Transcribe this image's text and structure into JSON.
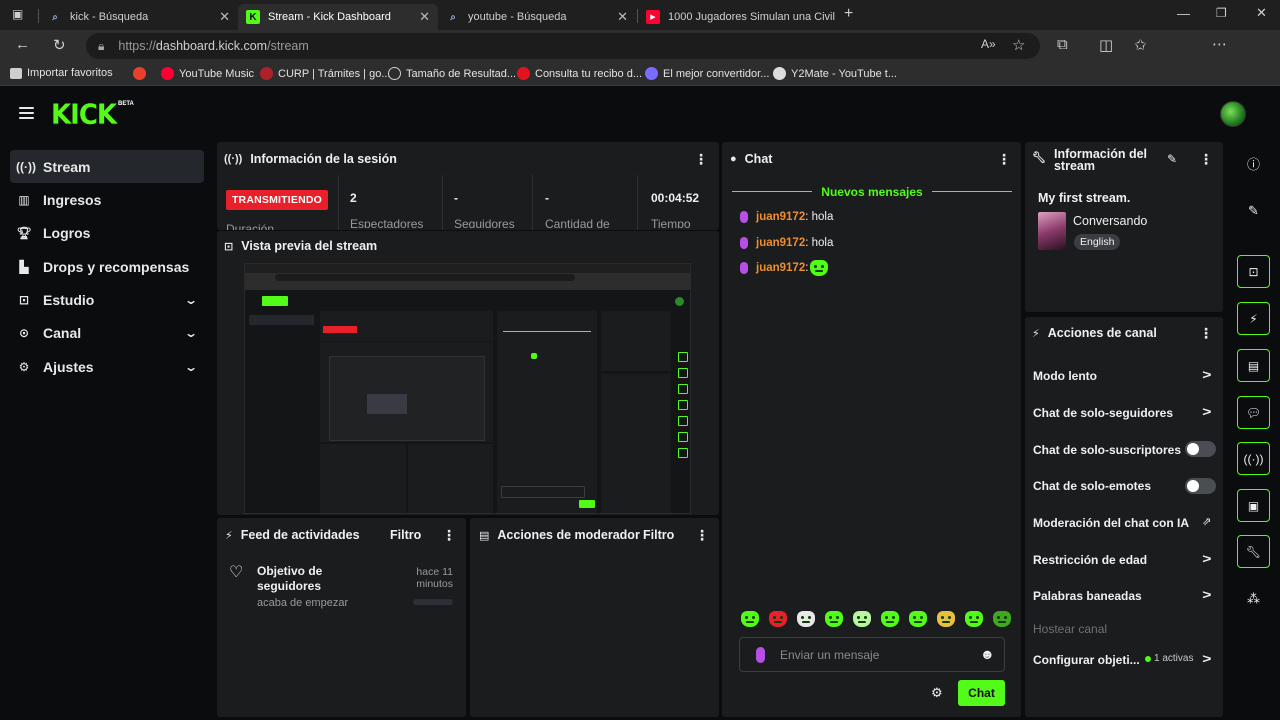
{
  "browser": {
    "tabs": [
      {
        "title": "kick - Búsqueda",
        "icon": "search-icon"
      },
      {
        "title": "Stream - Kick Dashboard",
        "icon": "kick-icon"
      },
      {
        "title": "youtube - Búsqueda",
        "icon": "search-icon"
      },
      {
        "title": "1000 Jugadores Simulan una Civil",
        "icon": "youtube-icon"
      }
    ],
    "url_prefix": "https://",
    "url_domain": "dashboard.kick.com",
    "url_path": "/stream",
    "bookmarks": [
      {
        "label": "Importar favoritos",
        "color": "#cfcfcf"
      },
      {
        "label": "",
        "color": "#e8402a"
      },
      {
        "label": "YouTube Music",
        "color": "#ff0033"
      },
      {
        "label": "CURP | Trámites | go...",
        "color": "#b0202a"
      },
      {
        "label": "Tamaño de Resultad...",
        "color": "#cfcfcf"
      },
      {
        "label": "Consulta tu recibo d...",
        "color": "#e0141e"
      },
      {
        "label": "El mejor convertidor...",
        "color": "#7a6cff"
      },
      {
        "label": "Y2Mate - YouTube t...",
        "color": "#dddddd"
      }
    ]
  },
  "header": {
    "logo": "KICK",
    "logo_badge": "BETA"
  },
  "sidebar": {
    "items": [
      {
        "label": "Stream",
        "icon": "broadcast-icon"
      },
      {
        "label": "Ingresos",
        "icon": "chart-icon"
      },
      {
        "label": "Logros",
        "icon": "trophy-icon"
      },
      {
        "label": "Drops y recompensas",
        "icon": "drops-icon"
      },
      {
        "label": "Estudio",
        "icon": "studio-icon"
      },
      {
        "label": "Canal",
        "icon": "channel-icon"
      },
      {
        "label": "Ajustes",
        "icon": "gear-icon"
      }
    ]
  },
  "session": {
    "title": "Información de la sesión",
    "status": "TRANSMITIENDO",
    "status_sub": "Duración",
    "stats": [
      {
        "value": "2",
        "label": "Espectadores"
      },
      {
        "value": "-",
        "label": "Seguidores"
      },
      {
        "value": "-",
        "label": "Cantidad de"
      },
      {
        "value": "00:04:52",
        "label": "Tiempo"
      }
    ]
  },
  "preview": {
    "title": "Vista previa del stream"
  },
  "activity": {
    "title": "Feed de actividades",
    "filter": "Filtro",
    "item_title": "Objetivo de seguidores",
    "item_sub": "acaba de empezar",
    "item_time": "hace 11 minutos"
  },
  "moderator": {
    "title": "Acciones de moderador",
    "filter": "Filtro"
  },
  "chat": {
    "title": "Chat",
    "new_messages": "Nuevos mensajes",
    "messages": [
      {
        "user": "juan9172",
        "text": ": hola"
      },
      {
        "user": "juan9172",
        "text": ": hola"
      },
      {
        "user": "juan9172",
        "text": ": "
      }
    ],
    "placeholder": "Enviar un mensaje",
    "send": "Chat"
  },
  "stream_info": {
    "title": "Información del stream",
    "stream_title": "My first stream.",
    "category": "Conversando",
    "language": "English"
  },
  "channel_actions": {
    "title": "Acciones de canal",
    "items": [
      {
        "label": "Modo lento",
        "control": "chevron"
      },
      {
        "label": "Chat de solo-seguidores",
        "control": "chevron"
      },
      {
        "label": "Chat de solo-suscriptores",
        "control": "toggle"
      },
      {
        "label": "Chat de solo-emotes",
        "control": "toggle"
      },
      {
        "label": "Moderación del chat con IA",
        "control": "external"
      },
      {
        "label": "Restricción de edad",
        "control": "chevron"
      },
      {
        "label": "Palabras baneadas",
        "control": "chevron"
      },
      {
        "label": "Hostear canal",
        "control": "none"
      },
      {
        "label": "Configurar objeti...",
        "control": "chevron"
      }
    ],
    "goals_active": "1 activas"
  },
  "colors": {
    "accent": "#53fc18",
    "live": "#e8202a",
    "panel": "#1a1c1e",
    "background": "#0b0c0d"
  }
}
